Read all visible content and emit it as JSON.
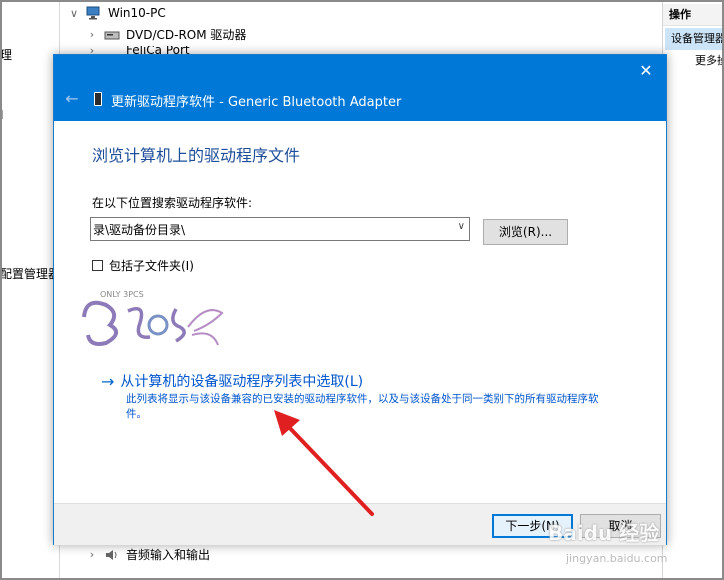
{
  "background": {
    "left_fragments": [
      "理",
      "I",
      "配置管理器"
    ],
    "tree": {
      "root": "Win10-PC",
      "items": [
        "DVD/CD-ROM 驱动器",
        "FeliCa Port",
        "音频输入和输出"
      ]
    },
    "actions_panel": {
      "header": "操作",
      "selected_item": "设备管理器",
      "more_item": "更多操作"
    }
  },
  "dialog": {
    "title": "更新驱动程序软件 - Generic Bluetooth Adapter",
    "heading": "浏览计算机上的驱动程序文件",
    "search_label": "在以下位置搜索驱动程序软件:",
    "path_value": "录\\驱动备份目录\\",
    "browse_label": "浏览(R)...",
    "include_subfolders_label": "包括子文件夹(I)",
    "include_subfolders_checked": false,
    "pick_link": "从计算机的设备驱动程序列表中选取(L)",
    "pick_description": "此列表将显示与该设备兼容的已安装的驱动程序软件，以及与该设备处于同一类别下的所有驱动程序软件。",
    "next_label": "下一步(N)",
    "cancel_label": "取消",
    "close_glyph": "✕",
    "back_glyph": "←"
  },
  "overlay": {
    "logo_text": "ONLY 3PCS",
    "watermark": "Baidu 经验",
    "watermark_url": "jingyan.baidu.com"
  },
  "colors": {
    "titlebar": "#0078d7",
    "heading": "#1e4e99",
    "link": "#0055cc",
    "annotation_arrow": "#e02020"
  }
}
